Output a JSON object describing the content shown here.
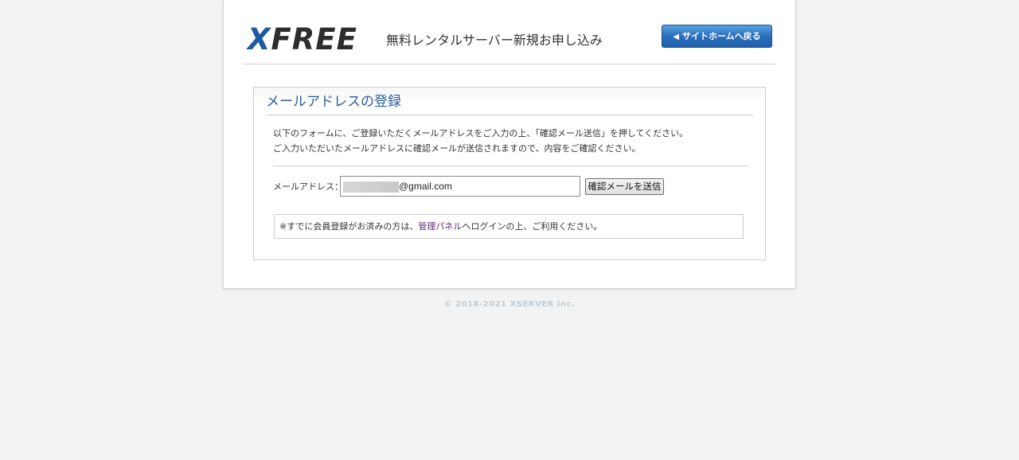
{
  "header": {
    "logo_x": "X",
    "logo_rest": "FREE",
    "title": "無料レンタルサーバー新規お申し込み",
    "home_button_label": "サイトホームへ戻る"
  },
  "form_box": {
    "title": "メールアドレスの登録",
    "intro_line1": "以下のフォームに、ご登録いただくメールアドレスをご入力の上、「確認メール送信」を押してください。",
    "intro_line2": "ご入力いただいたメールアドレスに確認メールが送信されますので、内容をご確認ください。",
    "email_label": "メールアドレス：",
    "email_value": "@gmail.com",
    "send_button_label": "確認メールを送信",
    "notice_prefix": "※すでに会員登録がお済みの方は、",
    "notice_link": "管理パネル",
    "notice_suffix": "へログインの上、ご利用ください。"
  },
  "footer": {
    "copyright": "© 2018-2021 XSERVER Inc."
  },
  "colors": {
    "accent_blue": "#2b5d9a",
    "button_blue": "#2a6fbc",
    "link_purple": "#5b2a7e"
  },
  "icons": {
    "home_button_chevron": "chevron-left-icon"
  }
}
